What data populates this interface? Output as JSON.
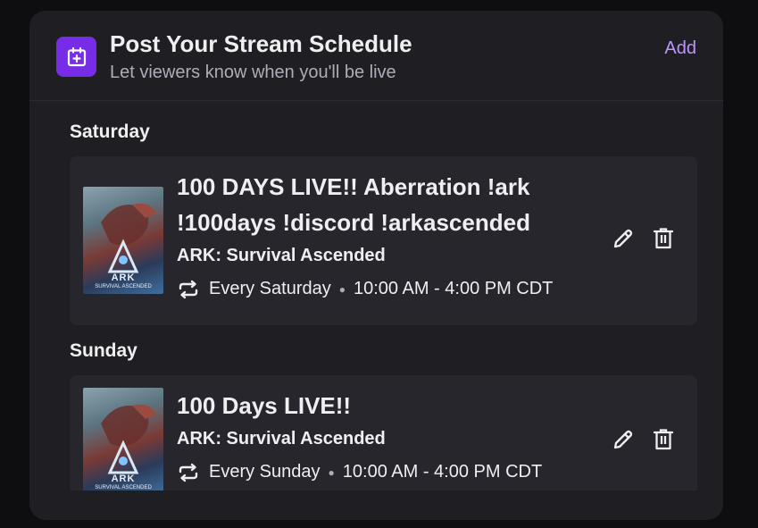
{
  "header": {
    "title": "Post Your Stream Schedule",
    "subtitle": "Let viewers know when you'll be live",
    "add_label": "Add",
    "icon": "calendar-plus-icon",
    "accent": "#772ce8",
    "link_color": "#bf94ff"
  },
  "schedule": [
    {
      "day": "Saturday",
      "title": "100 DAYS LIVE!! Aberration !ark !100days !discord !arkascended",
      "game": "ARK: Survival Ascended",
      "recurrence": "Every Saturday",
      "time": "10:00 AM - 4:00 PM CDT",
      "thumbnail_text": "ARK",
      "thumbnail_subtext": "SURVIVAL ASCENDED"
    },
    {
      "day": "Sunday",
      "title": "100 Days LIVE!!",
      "game": "ARK: Survival Ascended",
      "recurrence": "Every Sunday",
      "time": "10:00 AM - 4:00 PM CDT",
      "thumbnail_text": "ARK",
      "thumbnail_subtext": "SURVIVAL ASCENDED"
    }
  ],
  "icons": {
    "edit": "pencil-icon",
    "delete": "trash-icon",
    "repeat": "repeat-icon"
  }
}
